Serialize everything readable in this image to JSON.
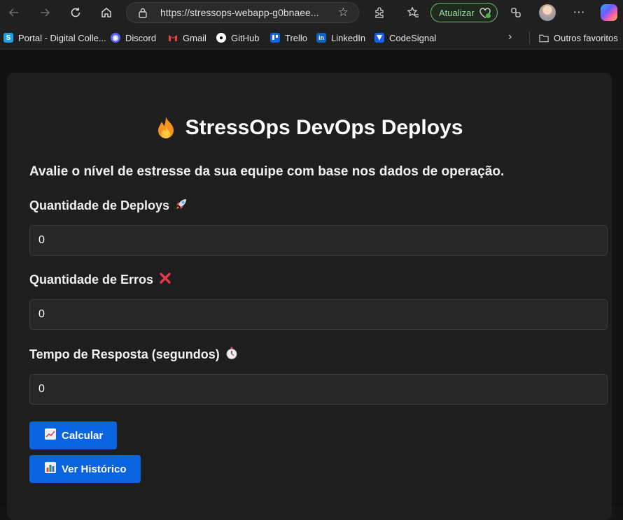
{
  "browser": {
    "url": "https://stressops-webapp-g0bnaee...",
    "update_label": "Atualizar",
    "bookmarks": [
      {
        "label": "Portal - Digital Colle...",
        "icon": "s-logo-icon",
        "color": "#1fa0e6"
      },
      {
        "label": "Discord",
        "icon": "discord-icon",
        "color": "#5865f2"
      },
      {
        "label": "Gmail",
        "icon": "gmail-icon",
        "color": "#ea4335"
      },
      {
        "label": "GitHub",
        "icon": "github-icon",
        "color": "#ffffff"
      },
      {
        "label": "Trello",
        "icon": "trello-icon",
        "color": "#0c66e4"
      },
      {
        "label": "LinkedIn",
        "icon": "linkedin-icon",
        "color": "#0a66c2"
      },
      {
        "label": "CodeSignal",
        "icon": "codesignal-icon",
        "color": "#1062fb"
      }
    ],
    "other_favorites": "Outros favoritos"
  },
  "app": {
    "title": "StressOps DevOps Deploys",
    "subtitle": "Avalie o nível de estresse da sua equipe com base nos dados de operação.",
    "fields": [
      {
        "label": "Quantidade de Deploys",
        "emoji": "🚀",
        "value": "0"
      },
      {
        "label": "Quantidade de Erros",
        "emoji": "❌",
        "value": "0"
      },
      {
        "label": "Tempo de Resposta (segundos)",
        "emoji": "⏱️",
        "value": "0"
      }
    ],
    "calc_button": "Calcular",
    "history_button": "Ver Histórico"
  },
  "colors": {
    "accent": "#0a64e0",
    "card_bg": "#1e1e1e",
    "page_bg": "#111111",
    "update_green": "#6fbf73"
  }
}
